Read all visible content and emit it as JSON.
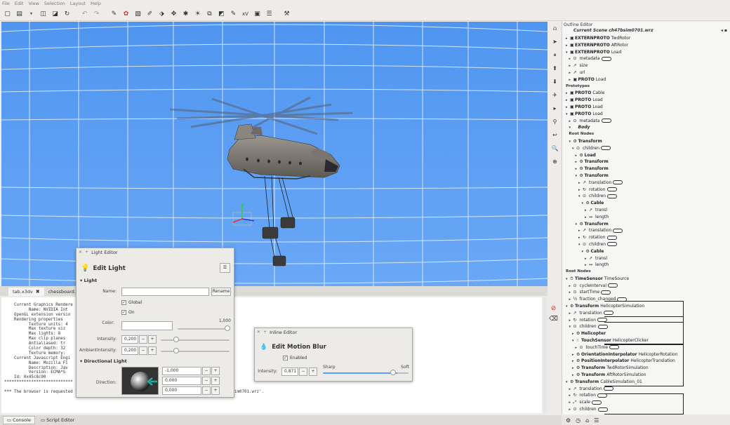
{
  "menu": [
    "File",
    "Edit",
    "View",
    "Selection",
    "Layout",
    "Help"
  ],
  "toolbar_icons": [
    "new-icon",
    "open-icon",
    "dropdown-icon",
    "save-icon",
    "save-as-icon",
    "reload-icon",
    "undo-icon",
    "redo-icon",
    "pick-icon",
    "color-icon",
    "image-icon",
    "path-icon",
    "move-icon",
    "rotate-icon",
    "scale-icon",
    "light-icon",
    "group-icon",
    "route-icon",
    "edit-icon",
    "script-icon",
    "field-icon",
    "list-icon",
    "tool-icon"
  ],
  "outline": {
    "title": "Outline Editor",
    "scene": "Current Scene ch47bsim0701.wrz",
    "rows": [
      {
        "indent": 0,
        "arrow": "▸",
        "icon": "▣",
        "bold": "EXTERNPROTO",
        "text": "TwdRotor"
      },
      {
        "indent": 0,
        "arrow": "▸",
        "icon": "▣",
        "bold": "EXTERNPROTO",
        "text": "AftRotor"
      },
      {
        "indent": 0,
        "arrow": "▾",
        "icon": "▣",
        "bold": "EXTERNPROTO",
        "text": "Load"
      },
      {
        "indent": 1,
        "arrow": "▸",
        "icon": "⊙",
        "bold": "",
        "text": "metadata",
        "tag": true
      },
      {
        "indent": 1,
        "arrow": "▸",
        "icon": "↗",
        "bold": "",
        "text": "size"
      },
      {
        "indent": 1,
        "arrow": "▸",
        "icon": "↗",
        "bold": "",
        "text": "url"
      },
      {
        "indent": 1,
        "arrow": "▸",
        "icon": "▣",
        "bold": "PROTO",
        "text": "Load"
      },
      {
        "indent": 0,
        "hdr": true,
        "text": "Prototypes"
      },
      {
        "indent": 0,
        "arrow": "▸",
        "icon": "▣",
        "bold": "PROTO",
        "text": "Cable"
      },
      {
        "indent": 0,
        "arrow": "▸",
        "icon": "▣",
        "bold": "PROTO",
        "text": "Load"
      },
      {
        "indent": 0,
        "arrow": "▸",
        "icon": "▣",
        "bold": "PROTO",
        "text": "Load"
      },
      {
        "indent": 0,
        "arrow": "▾",
        "icon": "▣",
        "bold": "PROTO",
        "text": "Load"
      },
      {
        "indent": 1,
        "arrow": "▸",
        "icon": "⊙",
        "bold": "",
        "text": "metadata",
        "tag": true
      },
      {
        "indent": 1,
        "arrow": "▾",
        "icon": "",
        "bold": "Body",
        "text": "",
        "italic": true
      },
      {
        "indent": 1,
        "hdr": true,
        "text": "Root Nodes"
      },
      {
        "indent": 1,
        "arrow": "▾",
        "icon": "⚙",
        "bold": "Transform",
        "text": ""
      },
      {
        "indent": 2,
        "arrow": "▾",
        "icon": "⊙",
        "bold": "",
        "text": "children",
        "tag": true
      },
      {
        "indent": 3,
        "arrow": "▸",
        "icon": "⚙",
        "bold": "Load",
        "text": ""
      },
      {
        "indent": 3,
        "arrow": "▸",
        "icon": "⚙",
        "bold": "Transform",
        "text": ""
      },
      {
        "indent": 3,
        "arrow": "▸",
        "icon": "⚙",
        "bold": "Transform",
        "text": ""
      },
      {
        "indent": 3,
        "arrow": "▾",
        "icon": "⚙",
        "bold": "Transform",
        "text": ""
      },
      {
        "indent": 4,
        "arrow": "▸",
        "icon": "↗",
        "bold": "",
        "text": "translation",
        "tag": true
      },
      {
        "indent": 4,
        "arrow": "▸",
        "icon": "↻",
        "bold": "",
        "text": "rotation",
        "tag": true
      },
      {
        "indent": 4,
        "arrow": "▾",
        "icon": "⊙",
        "bold": "",
        "text": "children",
        "tag": true
      },
      {
        "indent": 5,
        "arrow": "▾",
        "icon": "⚙",
        "bold": "Cable",
        "text": ""
      },
      {
        "indent": 6,
        "arrow": "▸",
        "icon": "↗",
        "bold": "",
        "text": "transl"
      },
      {
        "indent": 6,
        "arrow": "▸",
        "icon": "↔",
        "bold": "",
        "text": "length"
      },
      {
        "indent": 3,
        "arrow": "▾",
        "icon": "⚙",
        "bold": "Transform",
        "text": ""
      },
      {
        "indent": 4,
        "arrow": "▸",
        "icon": "↗",
        "bold": "",
        "text": "translation",
        "tag": true
      },
      {
        "indent": 4,
        "arrow": "▸",
        "icon": "↻",
        "bold": "",
        "text": "rotation",
        "tag": true
      },
      {
        "indent": 4,
        "arrow": "▾",
        "icon": "⊙",
        "bold": "",
        "text": "children",
        "tag": true
      },
      {
        "indent": 5,
        "arrow": "▾",
        "icon": "⚙",
        "bold": "Cable",
        "text": ""
      },
      {
        "indent": 6,
        "arrow": "▸",
        "icon": "↗",
        "bold": "",
        "text": "transl"
      },
      {
        "indent": 6,
        "arrow": "▸",
        "icon": "↔",
        "bold": "",
        "text": "length"
      },
      {
        "indent": 0,
        "hdr": true,
        "text": "Root Nodes"
      },
      {
        "indent": 0,
        "arrow": "▾",
        "icon": "⏱",
        "bold": "TimeSensor",
        "text": "TimeSource"
      },
      {
        "indent": 1,
        "arrow": "▸",
        "icon": "⊙",
        "bold": "",
        "text": "cycleInterval",
        "tag": true
      },
      {
        "indent": 1,
        "arrow": "▸",
        "icon": "⊙",
        "bold": "",
        "text": "startTime",
        "tag": true
      },
      {
        "indent": 1,
        "arrow": "▸",
        "icon": "½",
        "bold": "",
        "text": "fraction_changed",
        "tag": true
      },
      {
        "indent": 0,
        "arrow": "▾",
        "icon": "⚙",
        "bold": "Transform",
        "text": "HelicopterSimulation"
      },
      {
        "indent": 1,
        "arrow": "▸",
        "icon": "↗",
        "bold": "",
        "text": "translation",
        "tag": true
      },
      {
        "indent": 1,
        "arrow": "▸",
        "icon": "↻",
        "bold": "",
        "text": "rotation",
        "tag": true
      },
      {
        "indent": 1,
        "arrow": "▾",
        "icon": "⊙",
        "bold": "",
        "text": "children",
        "tag": true
      },
      {
        "indent": 2,
        "arrow": "▸",
        "icon": "⚙",
        "bold": "Helicopter",
        "text": ""
      },
      {
        "indent": 2,
        "arrow": "▾",
        "icon": "☝",
        "bold": "TouchSensor",
        "text": "HelicopterClicker"
      },
      {
        "indent": 3,
        "arrow": "▸",
        "icon": "⊙",
        "bold": "",
        "text": "touchTime",
        "tag": true
      },
      {
        "indent": 2,
        "arrow": "▸",
        "icon": "⚙",
        "bold": "OrientationInterpolator",
        "text": "HelicopterRotation"
      },
      {
        "indent": 2,
        "arrow": "▸",
        "icon": "⚙",
        "bold": "PositionInterpolator",
        "text": "HelicopterTranslation"
      },
      {
        "indent": 2,
        "arrow": "▸",
        "icon": "⚙",
        "bold": "Transform",
        "text": "TwdRotorSimulation"
      },
      {
        "indent": 2,
        "arrow": "▸",
        "icon": "⚙",
        "bold": "Transform",
        "text": "AftRotorSimulation"
      },
      {
        "indent": 0,
        "arrow": "▾",
        "icon": "⚙",
        "bold": "Transform",
        "text": "CableSimulation_01"
      },
      {
        "indent": 1,
        "arrow": "▸",
        "icon": "↗",
        "bold": "",
        "text": "translation",
        "tag": true
      },
      {
        "indent": 1,
        "arrow": "▸",
        "icon": "↻",
        "bold": "",
        "text": "rotation",
        "tag": true
      },
      {
        "indent": 1,
        "arrow": "▸",
        "icon": "⤢",
        "bold": "",
        "text": "scale",
        "tag": true
      },
      {
        "indent": 1,
        "arrow": "▸",
        "icon": "⊙",
        "bold": "",
        "text": "children",
        "tag": true
      }
    ]
  },
  "tabs": {
    "items": [
      "tab.x3dv",
      "chessboard.o"
    ]
  },
  "console": {
    "lines": [
      "    Current Graphics Rendere",
      "          Name: NVIDIA Int",
      "    OpenGL extension versio",
      "    Rendering properties",
      "          Texture units: 4",
      "          Max texture siz",
      "          Max lights: 8",
      "          Max clip planes",
      "          Antialiased: tr",
      "          Color depth: 32",
      "          Texture memory:",
      "    Current Javascript Engi",
      "          Name: Mozilla Fi",
      "          Description: Jav",
      "          Version: ECMA*S",
      "    Id: 0x45c8c00",
      "****************************",
      "",
      "*** The browser is requested to replace the world with 'http://blogofrog.com/files/vrml/ch47bsim0701.wrz'."
    ]
  },
  "bottom_tabs": [
    "Console",
    "Script Editor"
  ],
  "light_editor": {
    "title": "Light Editor",
    "heading": "Edit Light",
    "section_light": "Light",
    "name_label": "Name:",
    "name_value": "",
    "rename": "Rename",
    "global_label": "Global",
    "on_label": "On",
    "color_label": "Color:",
    "color_max": "1,000",
    "intensity_label": "Intensity:",
    "intensity_value": "0,200",
    "ambient_label": "AmbientIntensity:",
    "ambient_value": "0,200",
    "section_directional": "Directional Light",
    "direction_label": "Direction:",
    "dir_x": "-1,000",
    "dir_y": "0,000",
    "dir_z": "0,000",
    "minus": "−",
    "plus": "+"
  },
  "inline_editor": {
    "title": "Inline Editor",
    "heading": "Edit Motion Blur",
    "enabled_label": "Enabled",
    "intensity_label": "Intensity:",
    "intensity_value": "0,871",
    "sharp": "Sharp",
    "soft": "Soft",
    "blur_level": 0.87,
    "minus": "−",
    "plus": "+"
  }
}
